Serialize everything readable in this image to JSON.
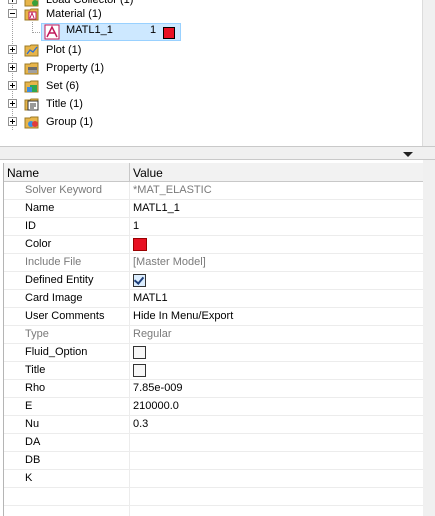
{
  "tree": {
    "items": [
      {
        "label": "Load Collector (1)",
        "icon": "load-collector-icon",
        "expander": "plus"
      },
      {
        "label": "Material (1)",
        "icon": "material-folder-icon",
        "expander": "minus"
      },
      {
        "label": "MATL1_1",
        "id": "1",
        "icon": "material-icon",
        "color": "#e81123",
        "selected": true
      },
      {
        "label": "Plot (1)",
        "icon": "plot-folder-icon",
        "expander": "plus"
      },
      {
        "label": "Property (1)",
        "icon": "property-folder-icon",
        "expander": "plus"
      },
      {
        "label": "Set (6)",
        "icon": "set-folder-icon",
        "expander": "plus"
      },
      {
        "label": "Title (1)",
        "icon": "title-folder-icon",
        "expander": "plus"
      },
      {
        "label": "Group (1)",
        "icon": "group-folder-icon",
        "expander": "plus"
      }
    ]
  },
  "table": {
    "col_name": "Name",
    "col_value": "Value",
    "rows": [
      {
        "name": "Solver Keyword",
        "value": "*MAT_ELASTIC",
        "grey": true
      },
      {
        "name": "Name",
        "value": "MATL1_1"
      },
      {
        "name": "ID",
        "value": "1"
      },
      {
        "name": "Color",
        "value": "",
        "swatch": "#e81123"
      },
      {
        "name": "Include File",
        "value": "[Master Model]",
        "grey": true
      },
      {
        "name": "Defined Entity",
        "value": "",
        "checkbox": true
      },
      {
        "name": "Card Image",
        "value": "MATL1"
      },
      {
        "name": "User Comments",
        "value": "Hide In Menu/Export"
      },
      {
        "name": "Type",
        "value": "Regular",
        "grey": true
      },
      {
        "name": "Fluid_Option",
        "value": "",
        "checkbox": false
      },
      {
        "name": "Title",
        "value": "",
        "checkbox": false
      },
      {
        "name": "Rho",
        "value": "7.85e-009"
      },
      {
        "name": "E",
        "value": "210000.0"
      },
      {
        "name": "Nu",
        "value": "0.3"
      },
      {
        "name": "DA",
        "value": ""
      },
      {
        "name": "DB",
        "value": ""
      },
      {
        "name": "K",
        "value": ""
      }
    ]
  },
  "colors": {
    "selection": "#cde8ff",
    "material_red": "#e81123"
  }
}
